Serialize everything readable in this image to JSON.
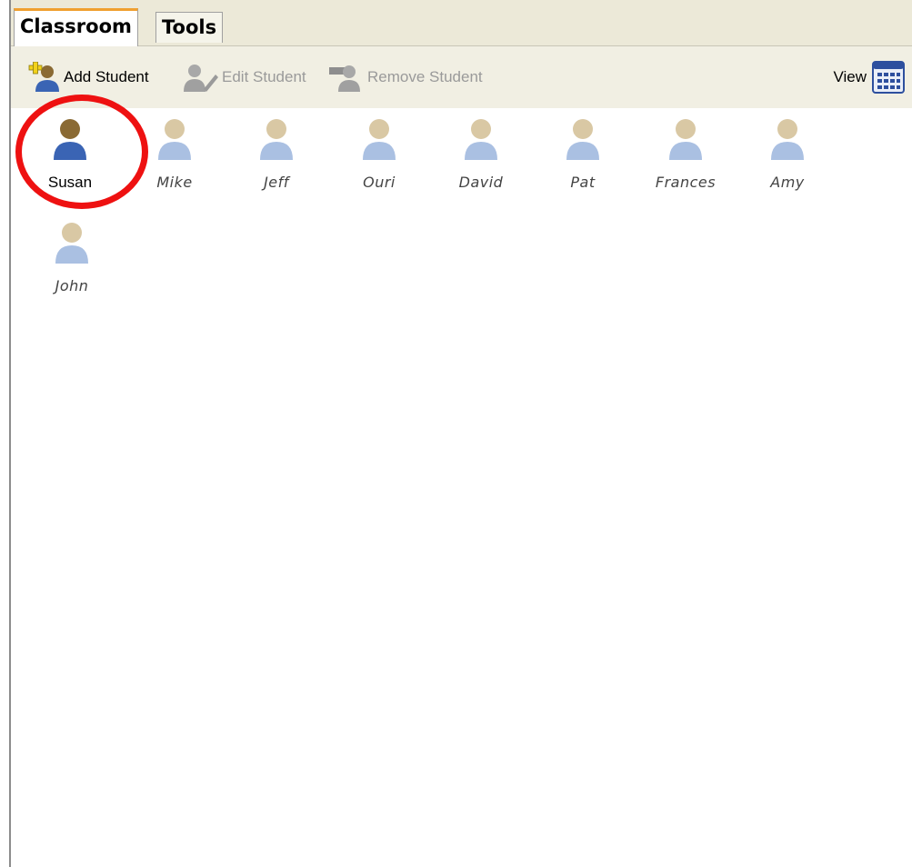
{
  "tabs": [
    {
      "label": "Classroom",
      "active": true
    },
    {
      "label": "Tools",
      "active": false
    }
  ],
  "toolbar": {
    "add_student": "Add Student",
    "edit_student": "Edit Student",
    "remove_student": "Remove Student",
    "view": "View"
  },
  "students": [
    {
      "name": "Susan",
      "selected": true,
      "present": true
    },
    {
      "name": "Mike",
      "selected": false,
      "present": false
    },
    {
      "name": "Jeff",
      "selected": false,
      "present": false
    },
    {
      "name": "Ouri",
      "selected": false,
      "present": false
    },
    {
      "name": "David",
      "selected": false,
      "present": false
    },
    {
      "name": "Pat",
      "selected": false,
      "present": false
    },
    {
      "name": "Frances",
      "selected": false,
      "present": false
    },
    {
      "name": "Amy",
      "selected": false,
      "present": false
    },
    {
      "name": "John",
      "selected": false,
      "present": false
    }
  ],
  "colors": {
    "accent_tab": "#f0a030",
    "highlight": "#ee1111",
    "toolbar_bg": "#f1efe3"
  }
}
